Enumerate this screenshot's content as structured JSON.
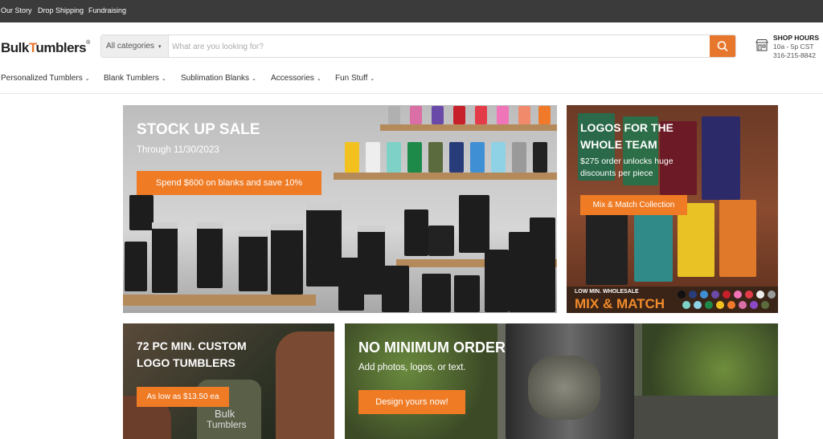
{
  "topbar": {
    "links": [
      "Our Story",
      "Drop Shipping",
      "Fundraising"
    ]
  },
  "logo": {
    "part1": "Bulk",
    "part2": "T",
    "part3": "umblers",
    "mark": "®"
  },
  "search": {
    "category": "All categories",
    "placeholder": "What are you looking for?"
  },
  "shop": {
    "title": "SHOP HOURS",
    "hours": "10a - 5p CST",
    "phone": "316-215-8842"
  },
  "nav": {
    "items": [
      "Personalized Tumblers",
      "Blank Tumblers",
      "Sublimation Blanks",
      "Accessories",
      "Fun Stuff"
    ]
  },
  "banners": {
    "stock": {
      "title": "STOCK UP SALE",
      "subtitle": "Through 11/30/2023",
      "cta": "Spend $600 on blanks and save 10%"
    },
    "logos": {
      "title_line1": "LOGOS FOR THE",
      "title_line2": "WHOLE TEAM",
      "desc_line1": "$275 order unlocks huge",
      "desc_line2": "discounts per piece",
      "cta": "Mix & Match Collection",
      "strip_line1": "LOW MIN. WHOLESALE",
      "strip_line2": "MIX & MATCH"
    },
    "custom": {
      "title_line1": "72 PC MIN. CUSTOM",
      "title_line2": "LOGO TUMBLERS",
      "cta": "As low as $13.50 ea",
      "bottle_line1": "Bulk",
      "bottle_line2": "Tumblers"
    },
    "nomin": {
      "title": "NO MINIMUM ORDER",
      "subtitle": "Add photos, logos, or text.",
      "cta": "Design yours now!"
    }
  },
  "colors": {
    "accent": "#e8772e",
    "topbar": "#3b3b3b"
  },
  "icons": {
    "search": "search-icon",
    "store": "store-icon",
    "chevron": "chevron-down-icon"
  }
}
